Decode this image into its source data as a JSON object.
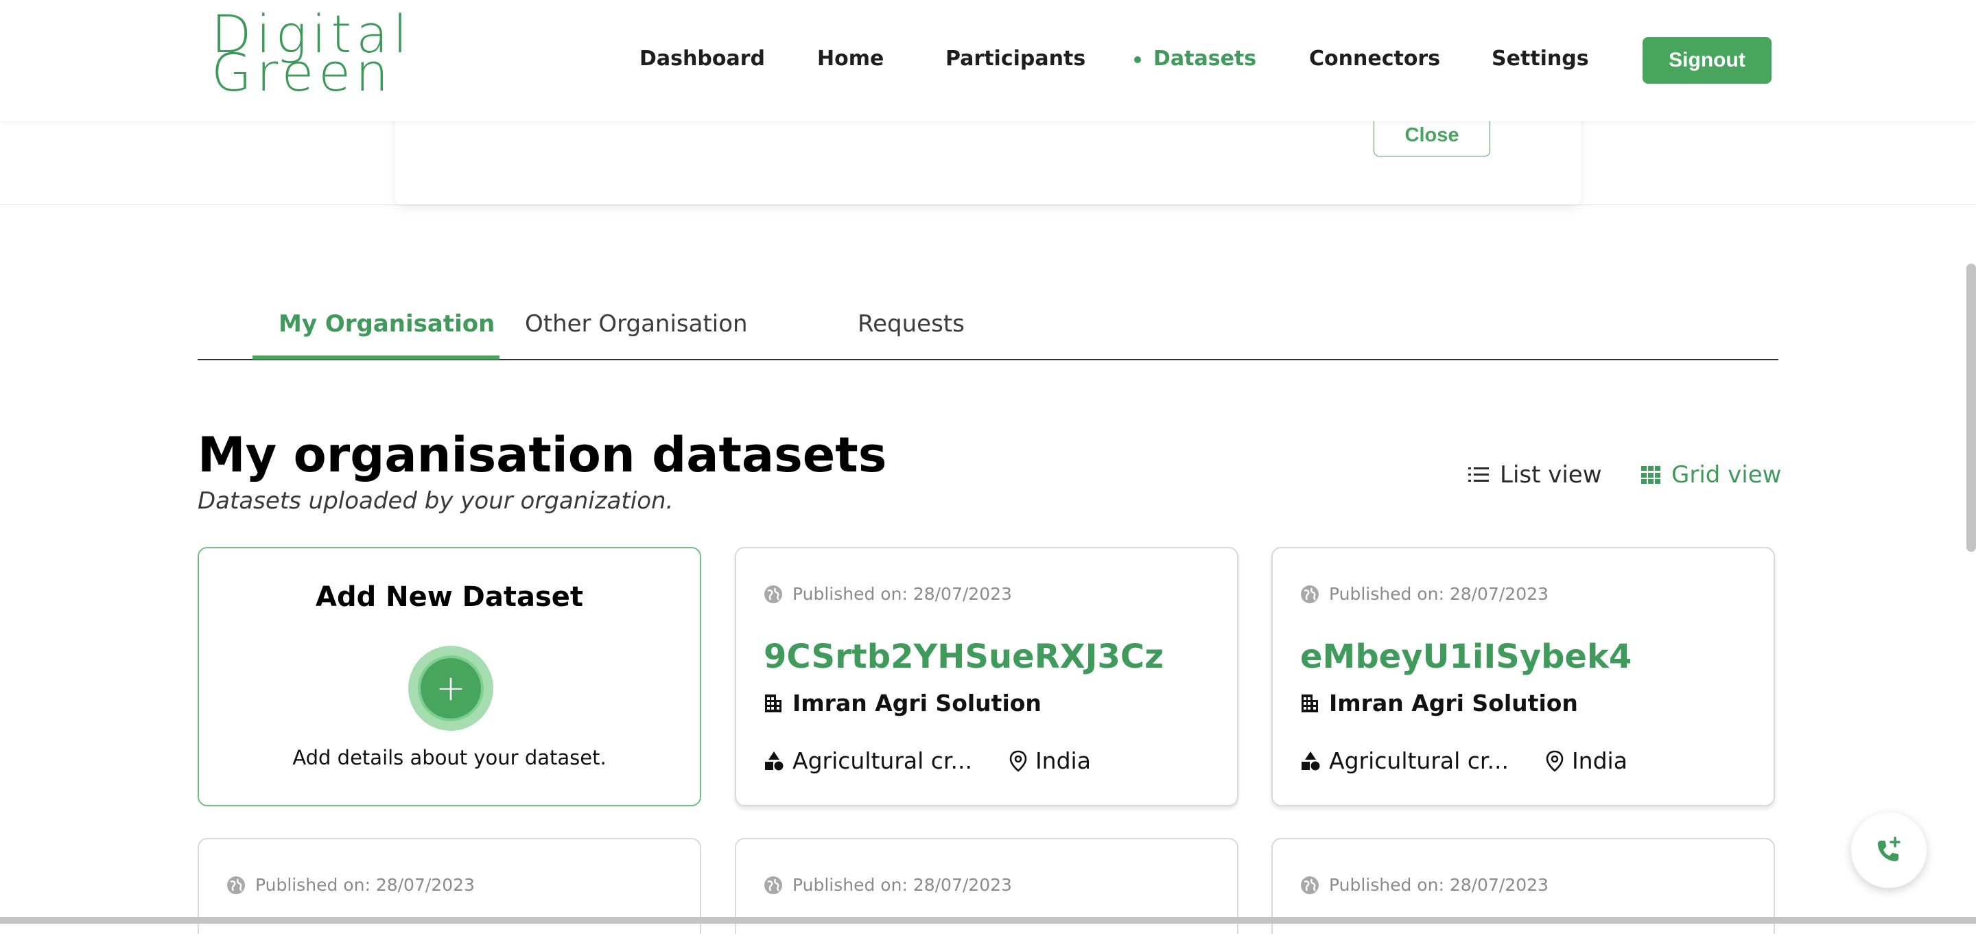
{
  "brand": {
    "logo_line1": "Digital",
    "logo_line2": "Green"
  },
  "nav": {
    "items": [
      {
        "label": "Dashboard"
      },
      {
        "label": "Home"
      },
      {
        "label": "Participants"
      },
      {
        "label": "Datasets",
        "active": true
      },
      {
        "label": "Connectors"
      },
      {
        "label": "Settings"
      }
    ],
    "signout_label": "Signout"
  },
  "banner": {
    "close_label": "Close"
  },
  "tabs": [
    {
      "label": "My Organisation",
      "active": true
    },
    {
      "label": "Other Organisation"
    },
    {
      "label": "Requests"
    }
  ],
  "section": {
    "title": "My organisation datasets",
    "subtitle": "Datasets uploaded by your organization."
  },
  "views": {
    "list_label": "List view",
    "grid_label": "Grid view",
    "selected": "Grid view"
  },
  "add_card": {
    "title": "Add New Dataset",
    "description": "Add details about your dataset."
  },
  "datasets": [
    {
      "published": "Published on: 28/07/2023",
      "name": "9CSrtb2YHSueRXJ3Cz",
      "organization": "Imran Agri Solution",
      "category": "Agricultural cr...",
      "location": "India"
    },
    {
      "published": "Published on: 28/07/2023",
      "name": "eMbeyU1iISybek4",
      "organization": "Imran Agri Solution",
      "category": "Agricultural cr...",
      "location": "India"
    },
    {
      "published": "Published on: 28/07/2023"
    },
    {
      "published": "Published on: 28/07/2023"
    },
    {
      "published": "Published on: 28/07/2023"
    }
  ],
  "colors": {
    "brand_green": "#3f9a5b",
    "button_green": "#47a55e",
    "text": "#1e1e1e",
    "muted": "#8a8a8a"
  },
  "icons": {
    "list_view": "list-icon",
    "grid_view": "grid-icon",
    "published": "globe-icon",
    "organization": "building-icon",
    "category": "shapes-icon",
    "location": "location-pin-icon",
    "fab": "phone-plus-icon"
  }
}
